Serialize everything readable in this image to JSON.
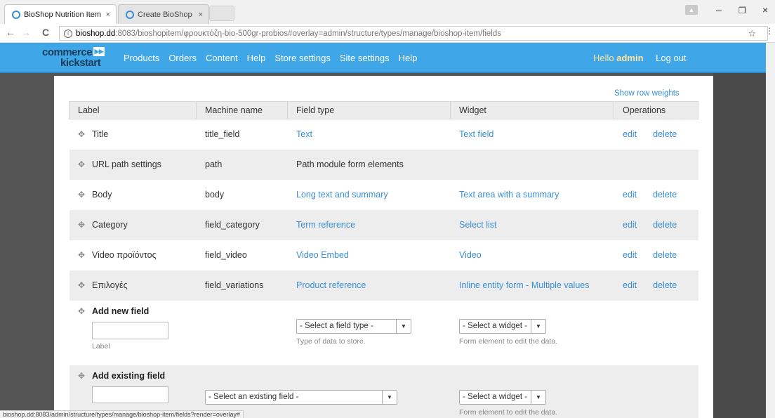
{
  "browser": {
    "tabs": [
      {
        "title": "BioShop Nutrition Item |",
        "active": true
      },
      {
        "title": "Create BioShop Nutrition",
        "active": false
      }
    ],
    "url_host": "bioshop.dd",
    "url_rest": ":8083/bioshopitem/φρουκτόζη-bio-500gr-probios#overlay=admin/structure/types/manage/bioshop-item/fields",
    "status_url": "bioshop.dd:8083/admin/structure/types/manage/bioshop-item/fields?render=overlay#",
    "back": "←",
    "forward": "→",
    "reload": "C",
    "info": "i",
    "star": "☆",
    "menu": "⋮",
    "close": "×",
    "minimize": "–",
    "restore": "❐",
    "profile": "▲"
  },
  "adminbar": {
    "logo_top": "commerce",
    "logo_bottom": "kickstart",
    "menu": [
      "Products",
      "Orders",
      "Content",
      "Help",
      "Store settings",
      "Site settings",
      "Help"
    ],
    "hello": "Hello ",
    "username": "admin",
    "logout": "Log out"
  },
  "show_row_weights": "Show row weights",
  "table": {
    "headers": [
      "Label",
      "Machine name",
      "Field type",
      "Widget",
      "Operations"
    ],
    "rows": [
      {
        "label": "Title",
        "machine": "title_field",
        "type": "Text",
        "widget": "Text field",
        "edit": "edit",
        "delete": "delete"
      },
      {
        "label": "URL path settings",
        "machine": "path",
        "type": "Path module form elements",
        "widget": "",
        "edit": "",
        "delete": ""
      },
      {
        "label": "Body",
        "machine": "body",
        "type": "Long text and summary",
        "widget": "Text area with a summary",
        "edit": "edit",
        "delete": "delete"
      },
      {
        "label": "Category",
        "machine": "field_category",
        "type": "Term reference",
        "widget": "Select list",
        "edit": "edit",
        "delete": "delete"
      },
      {
        "label": "Video προϊόντος",
        "machine": "field_video",
        "type": "Video Embed",
        "widget": "Video",
        "edit": "edit",
        "delete": "delete"
      },
      {
        "label": "Επιλογές",
        "machine": "field_variations",
        "type": "Product reference",
        "widget": "Inline entity form - Multiple values",
        "edit": "edit",
        "delete": "delete"
      }
    ],
    "add_new": {
      "title": "Add new field",
      "label_desc": "Label",
      "field_type_select": "- Select a field type -",
      "field_type_desc": "Type of data to store.",
      "widget_select": "- Select a widget -",
      "widget_desc": "Form element to edit the data."
    },
    "add_existing": {
      "title": "Add existing field",
      "existing_select": "- Select an existing field -",
      "widget_select": "- Select a widget -",
      "widget_desc": "Form element to edit the data."
    }
  },
  "colors": {
    "adminbar": "#3fa7e8",
    "link": "#3a8fd6",
    "overlay": "#555555"
  }
}
